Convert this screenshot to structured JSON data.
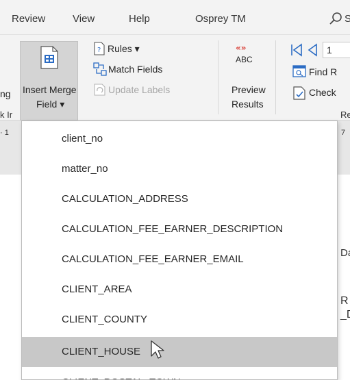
{
  "tabs": [
    {
      "label": "Review"
    },
    {
      "label": "View"
    },
    {
      "label": "Help"
    },
    {
      "label": "Osprey TM"
    }
  ],
  "search_partial": "S",
  "ribbon": {
    "left_fragment_1": "ng",
    "insert_merge_field": {
      "line1": "Insert Merge",
      "line2": "Field ▾"
    },
    "rules_label": "Rules ▾",
    "match_fields_label": "Match Fields",
    "update_labels_label": "Update Labels",
    "abc_label": "ABC",
    "preview_results": {
      "line1": "Preview",
      "line2": "Results"
    },
    "record_partial": "1",
    "find_partial": "Find R",
    "check_partial": "Check",
    "left_fragment_2": "k Ir",
    "right_fragment": "Re"
  },
  "ruler": {
    "left": "· 1",
    "right": "7"
  },
  "doc_fragments": {
    "a": "Da",
    "b": "R",
    "c": "_D"
  },
  "dropdown": {
    "items": [
      {
        "label": "client_no"
      },
      {
        "label": "matter_no"
      },
      {
        "label": "CALCULATION_ADDRESS"
      },
      {
        "label": "CALCULATION_FEE_EARNER_DESCRIPTION"
      },
      {
        "label": "CALCULATION_FEE_EARNER_EMAIL"
      },
      {
        "label": "CLIENT_AREA"
      },
      {
        "label": "CLIENT_COUNTY"
      },
      {
        "label": "CLIENT_HOUSE"
      },
      {
        "label": "CLIENT_POSTAL_TOWN"
      }
    ],
    "hovered_index": 7
  },
  "colors": {
    "ribbon_bg": "#f3f3f3",
    "hover_bg": "#c8c8c8",
    "accent_blue": "#2b6cc4",
    "accent_red": "#d9443c"
  }
}
